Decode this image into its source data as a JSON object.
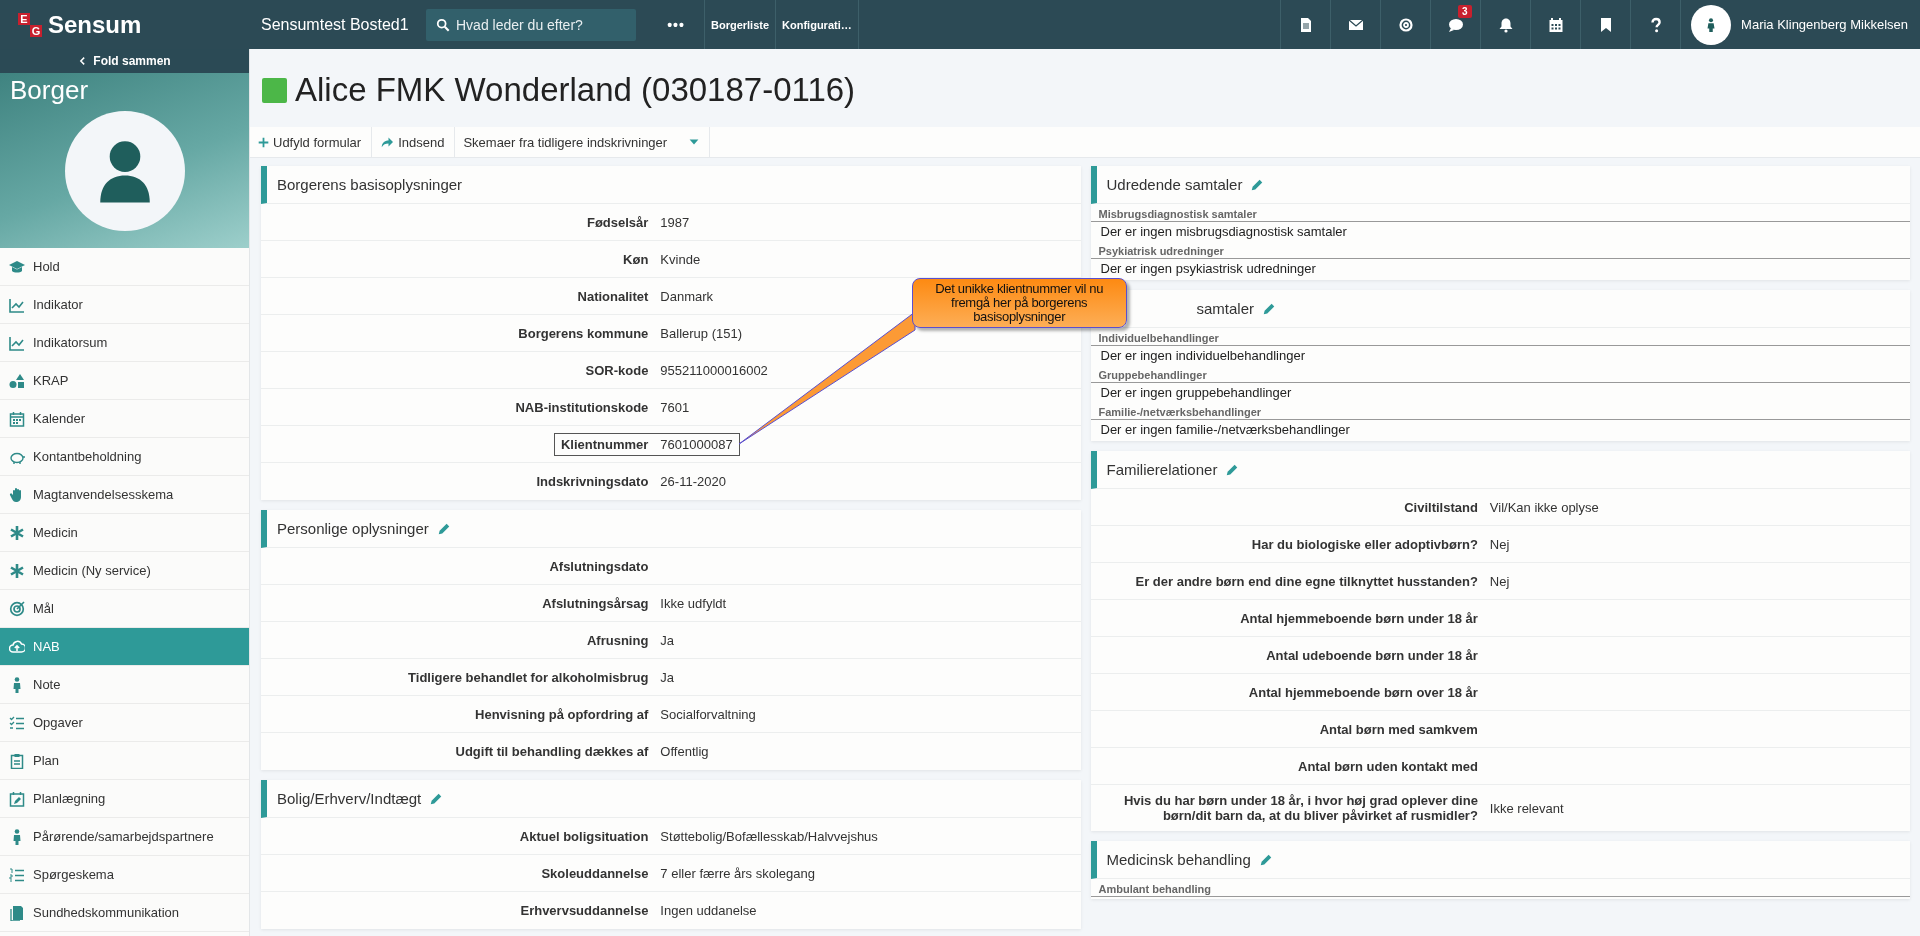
{
  "topbar": {
    "logo_letters": [
      "E",
      "G"
    ],
    "brand": "Sensum",
    "location": "Sensumtest Bosted1",
    "search": {
      "placeholder": "Hvad leder du efter?"
    },
    "more": "•••",
    "links": [
      "Borgerliste",
      "Konfigurati…"
    ],
    "chat_badge": "3",
    "user": {
      "name": "Maria Klingenberg Mikkelsen"
    }
  },
  "sidebar": {
    "collapse": "Fold sammen",
    "heading": "Borger",
    "items": [
      {
        "label": "Hold",
        "selected": false
      },
      {
        "label": "Indikator",
        "selected": false
      },
      {
        "label": "Indikatorsum",
        "selected": false
      },
      {
        "label": "KRAP",
        "selected": false
      },
      {
        "label": "Kalender",
        "selected": false
      },
      {
        "label": "Kontantbeholdning",
        "selected": false
      },
      {
        "label": "Magtanvendelsesskema",
        "selected": false
      },
      {
        "label": "Medicin",
        "selected": false
      },
      {
        "label": "Medicin (Ny service)",
        "selected": false
      },
      {
        "label": "Mål",
        "selected": false
      },
      {
        "label": "NAB",
        "selected": true
      },
      {
        "label": "Note",
        "selected": false
      },
      {
        "label": "Opgaver",
        "selected": false
      },
      {
        "label": "Plan",
        "selected": false
      },
      {
        "label": "Planlægning",
        "selected": false
      },
      {
        "label": "Pårørende/samarbejdspartnere",
        "selected": false
      },
      {
        "label": "Spørgeskema",
        "selected": false
      },
      {
        "label": "Sundhedskommunikation",
        "selected": false
      }
    ]
  },
  "header": {
    "title": "Alice FMK Wonderland (030187-0116)",
    "toolbar": [
      {
        "kind": "add",
        "label": "Udfyld formular"
      },
      {
        "kind": "send",
        "label": "Indsend"
      },
      {
        "kind": "dropdown",
        "label": "Skemaer fra tidligere indskrivninger"
      }
    ]
  },
  "left_column": [
    {
      "kind": "fields",
      "title": "Borgerens basisoplysninger",
      "editable": false,
      "covered": false,
      "rows": [
        {
          "label": "Fødselsår",
          "value": "1987",
          "outlined": false
        },
        {
          "label": "Køn",
          "value": "Kvinde",
          "outlined": false
        },
        {
          "label": "Nationalitet",
          "value": "Danmark",
          "outlined": false
        },
        {
          "label": "Borgerens kommune",
          "value": "Ballerup (151)",
          "outlined": false
        },
        {
          "label": "SOR-kode",
          "value": "955211000016002",
          "outlined": false
        },
        {
          "label": "NAB-institutionskode",
          "value": "7601",
          "outlined": false
        },
        {
          "label": "Klientnummer",
          "value": "7601000087",
          "outlined": true
        },
        {
          "label": "Indskrivningsdato",
          "value": "26-11-2020",
          "outlined": false
        }
      ]
    },
    {
      "kind": "fields",
      "title": "Personlige oplysninger",
      "editable": true,
      "covered": false,
      "rows": [
        {
          "label": "Afslutningsdato",
          "outlined": false
        },
        {
          "label": "Afslutningsårsag",
          "value": "Ikke udfyldt",
          "outlined": false
        },
        {
          "label": "Afrusning",
          "value": "Ja",
          "outlined": false
        },
        {
          "label": "Tidligere behandlet for alkoholmisbrug",
          "value": "Ja",
          "outlined": false
        },
        {
          "label": "Henvisning på opfordring af",
          "value": "Socialforvaltning",
          "outlined": false
        },
        {
          "label": "Udgift til behandling dækkes af",
          "value": "Offentlig",
          "outlined": false
        }
      ]
    },
    {
      "kind": "fields",
      "title": "Bolig/Erhverv/Indtægt",
      "editable": true,
      "covered": false,
      "rows": [
        {
          "label": "Aktuel boligsituation",
          "value": "Støttebolig/Bofællesskab/Halvvejshus",
          "outlined": false
        },
        {
          "label": "Skoleuddannelse",
          "value": "7 eller færre års skolegang",
          "outlined": false
        },
        {
          "label": "Erhvervsuddannelse",
          "value": "Ingen uddanelse",
          "outlined": false
        }
      ]
    }
  ],
  "right_column": [
    {
      "kind": "lists",
      "title": "Udredende samtaler",
      "editable": true,
      "covered": false,
      "sections": [
        {
          "heading": "Misbrugsdiagnostisk samtaler",
          "text": "Der er ingen misbrugsdiagnostisk samtaler"
        },
        {
          "heading": "Psykiatrisk udredninger",
          "text": "Der er ingen psykiastrisk udredninger"
        }
      ]
    },
    {
      "kind": "lists",
      "title": "samtaler",
      "editable": true,
      "covered": true,
      "sections": [
        {
          "heading": "Individuelbehandlinger",
          "text": "Der er ingen individuelbehandlinger"
        },
        {
          "heading": "Gruppebehandlinger",
          "text": "Der er ingen gruppebehandlinger"
        },
        {
          "heading": "Familie-/netværksbehandlinger",
          "text": "Der er ingen familie-/netværksbehandlinger"
        }
      ]
    },
    {
      "kind": "fields",
      "title": "Familierelationer",
      "editable": true,
      "covered": false,
      "rows": [
        {
          "label": "Civiltilstand",
          "value": "Vil/Kan ikke oplyse",
          "outlined": false
        },
        {
          "label": "Har du biologiske eller adoptivbørn?",
          "value": "Nej",
          "outlined": false
        },
        {
          "label": "Er der andre børn end dine egne tilknyttet husstanden?",
          "value": "Nej",
          "outlined": false
        },
        {
          "label": "Antal hjemmeboende børn under 18 år",
          "outlined": false
        },
        {
          "label": "Antal udeboende børn under 18 år",
          "outlined": false
        },
        {
          "label": "Antal hjemmeboende børn over 18 år",
          "outlined": false
        },
        {
          "label": "Antal børn med samkvem",
          "outlined": false
        },
        {
          "label": "Antal børn uden kontakt med",
          "outlined": false
        },
        {
          "label": "Hvis du har børn under 18 år, i hvor høj grad oplever dine børn/dit barn da, at du bliver påvirket af rusmidler?",
          "value": "Ikke relevant",
          "outlined": false
        }
      ]
    },
    {
      "kind": "lists",
      "title": "Medicinsk behandling",
      "editable": true,
      "covered": false,
      "sections": [
        {
          "heading": "Ambulant behandling"
        }
      ]
    }
  ],
  "callout": {
    "text": "Det unikke klientnummer vil nu fremgå her på borgerens basisoplysninger"
  }
}
